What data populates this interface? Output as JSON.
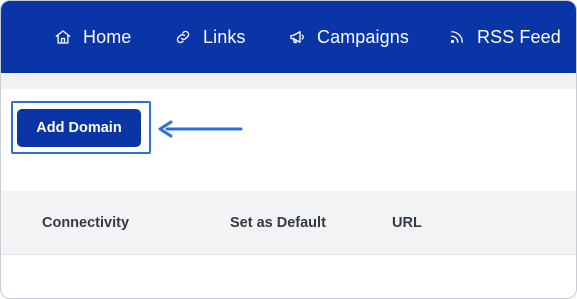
{
  "nav": {
    "items": [
      {
        "label": "Home",
        "icon": "home-icon"
      },
      {
        "label": "Links",
        "icon": "link-icon"
      },
      {
        "label": "Campaigns",
        "icon": "megaphone-icon"
      },
      {
        "label": "RSS Feed",
        "icon": "rss-icon"
      }
    ]
  },
  "actions": {
    "add_domain_label": "Add Domain"
  },
  "table": {
    "columns": [
      "Connectivity",
      "Set as Default",
      "URL"
    ]
  },
  "colors": {
    "brand": "#0a35a6",
    "highlight": "#2d6fd6",
    "header_bg": "#f2f3f5"
  }
}
